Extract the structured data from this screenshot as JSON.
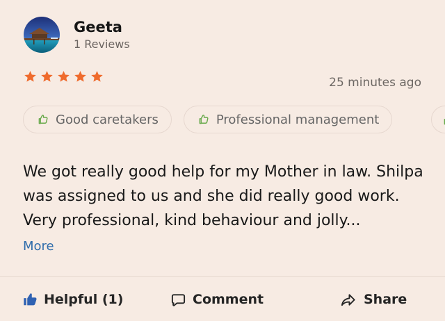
{
  "reviewer": {
    "name": "Geeta",
    "reviews": "1 Reviews"
  },
  "rating": {
    "value": 5,
    "max": 5
  },
  "timestamp": "25 minutes ago",
  "tags": [
    {
      "label": "Good caretakers"
    },
    {
      "label": "Professional management"
    }
  ],
  "review": {
    "text": "We got really good help for my Mother in law. Shilpa was assigned to us and she did really good work. Very professional, kind behaviour and jolly...",
    "more_label": "More"
  },
  "actions": {
    "helpful_label": "Helpful (1)",
    "comment_label": "Comment",
    "share_label": "Share"
  },
  "colors": {
    "background": "#f7ebe3",
    "star": "#ef6b2d",
    "link": "#2f6cab",
    "helpful_icon": "#2f61b2"
  }
}
